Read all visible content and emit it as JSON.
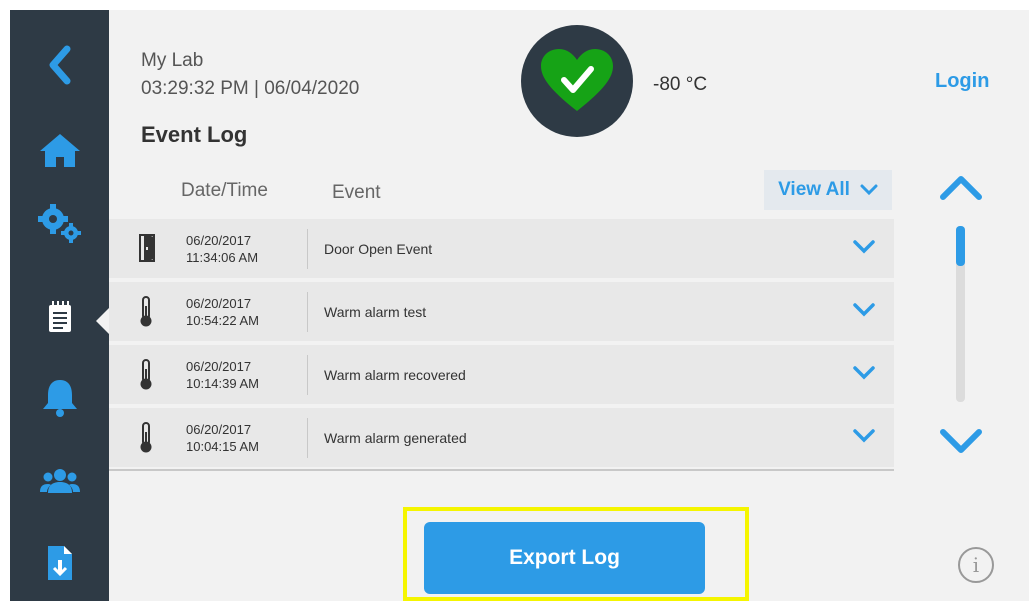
{
  "header": {
    "lab_name": "My Lab",
    "datetime": "03:29:32 PM | 06/04/2020",
    "page_title": "Event Log",
    "temperature": "-80 °C",
    "login_label": "Login",
    "status_icon": "heart-check-icon",
    "status_color": "#16a316"
  },
  "sidebar": {
    "items": [
      {
        "name": "back",
        "icon": "chevron-left-icon",
        "active": false
      },
      {
        "name": "home",
        "icon": "home-icon",
        "active": false
      },
      {
        "name": "settings",
        "icon": "gears-icon",
        "active": false
      },
      {
        "name": "event-log",
        "icon": "notepad-icon",
        "active": true
      },
      {
        "name": "alarms",
        "icon": "bell-icon",
        "active": false
      },
      {
        "name": "users",
        "icon": "users-icon",
        "active": false
      },
      {
        "name": "download",
        "icon": "file-download-icon",
        "active": false
      }
    ]
  },
  "table": {
    "columns": [
      "Date/Time",
      "Event"
    ],
    "filter_label": "View All",
    "rows": [
      {
        "date": "06/20/2017",
        "time": "11:34:06 AM",
        "event": "Door Open Event",
        "icon": "door-icon"
      },
      {
        "date": "06/20/2017",
        "time": "10:54:22 AM",
        "event": "Warm alarm test",
        "icon": "thermometer-icon"
      },
      {
        "date": "06/20/2017",
        "time": "10:14:39 AM",
        "event": "Warm alarm recovered",
        "icon": "thermometer-icon"
      },
      {
        "date": "06/20/2017",
        "time": "10:04:15 AM",
        "event": "Warm alarm generated",
        "icon": "thermometer-icon"
      }
    ]
  },
  "actions": {
    "export_label": "Export Log",
    "info_label": "i"
  },
  "colors": {
    "accent": "#2d9be6",
    "sidebar": "#2e3a45",
    "highlight": "#f5f500"
  }
}
